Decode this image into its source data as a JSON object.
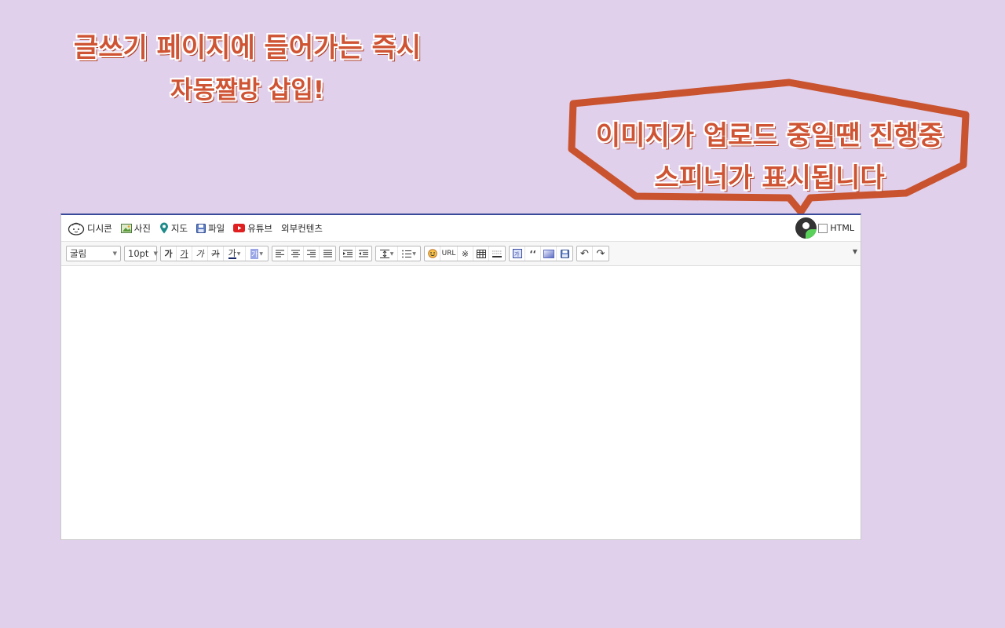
{
  "promo": {
    "headline_line1": "글쓰기 페이지에 들어가는 즉시",
    "headline_line2": "자동짤방 삽입!",
    "bubble_line1": "이미지가 업로드 중일땐 진행중",
    "bubble_line2": "스피너가 표시됩니다"
  },
  "colors": {
    "background": "#e0d0ec",
    "promo_text": "#cf5434",
    "bubble_border": "#c9532f",
    "editor_top_border": "#3a4a9a"
  },
  "insert_bar": {
    "items": [
      {
        "label": "디시콘",
        "icon": "dccon-icon"
      },
      {
        "label": "사진",
        "icon": "photo-icon"
      },
      {
        "label": "지도",
        "icon": "map-pin-icon"
      },
      {
        "label": "파일",
        "icon": "file-disk-icon"
      },
      {
        "label": "유튜브",
        "icon": "youtube-icon"
      },
      {
        "label": "외부컨텐츠",
        "icon": ""
      }
    ],
    "html_toggle_label": "HTML"
  },
  "format_bar": {
    "font_family": "굴림",
    "font_size": "10pt",
    "bold": "가",
    "underline": "가",
    "italic": "가",
    "strike": "가",
    "text_color": "가",
    "bg_color": "가",
    "url": "URL",
    "special_char": "※",
    "quote": "‘‘",
    "undo": "↶",
    "redo": "↷"
  }
}
